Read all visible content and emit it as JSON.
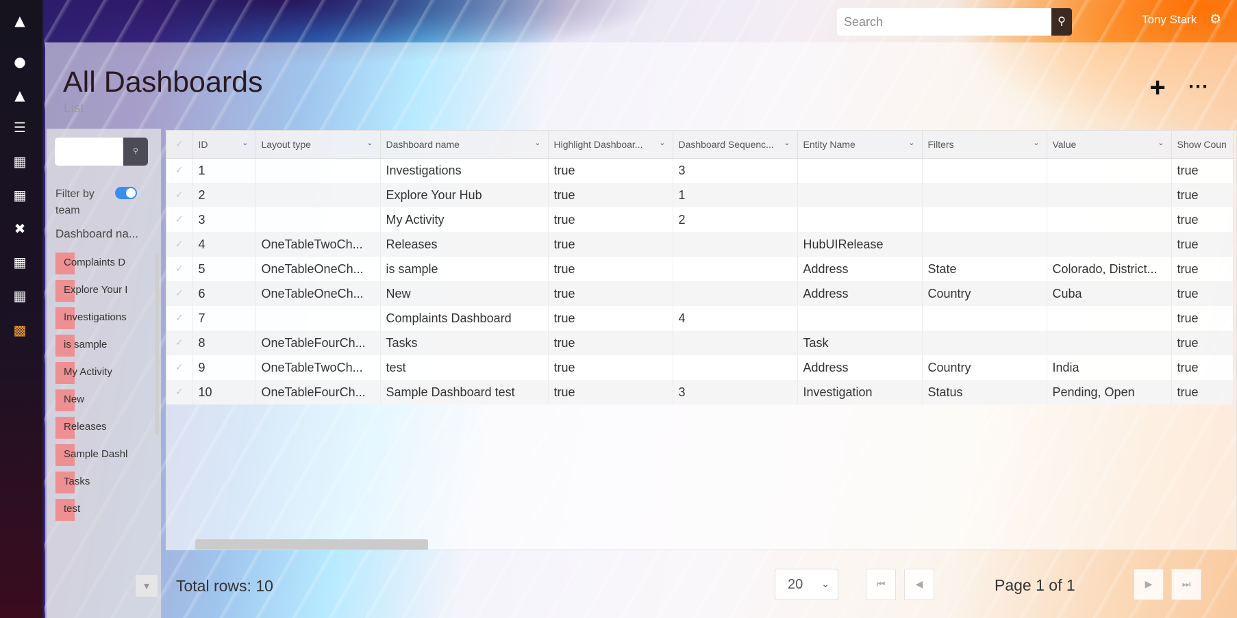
{
  "topbar": {
    "search_placeholder": "Search",
    "user_name": "Tony Stark"
  },
  "page": {
    "title": "All Dashboards",
    "subtitle": "List"
  },
  "filter_panel": {
    "filter_by_team_label": "Filter by team",
    "filter_by_team_enabled": true,
    "column_header": "Dashboard na...",
    "items": [
      "Complaints D",
      "Explore Your I",
      "Investigations",
      "is sample",
      "My Activity",
      "New",
      "Releases",
      "Sample Dashl",
      "Tasks",
      "test"
    ]
  },
  "grid": {
    "columns": [
      "ID",
      "Layout type",
      "Dashboard name",
      "Highlight Dashboar...",
      "Dashboard Sequenc...",
      "Entity Name",
      "Filters",
      "Value",
      "Show Coun"
    ],
    "rows": [
      [
        "1",
        "",
        "Investigations",
        "true",
        "3",
        "",
        "",
        "",
        "true"
      ],
      [
        "2",
        "",
        "Explore Your Hub",
        "true",
        "1",
        "",
        "",
        "",
        "true"
      ],
      [
        "3",
        "",
        "My Activity",
        "true",
        "2",
        "",
        "",
        "",
        "true"
      ],
      [
        "4",
        "OneTableTwoCh...",
        "Releases",
        "true",
        "",
        "HubUIRelease",
        "",
        "",
        "true"
      ],
      [
        "5",
        "OneTableOneCh...",
        "is sample",
        "true",
        "",
        "Address",
        "State",
        "Colorado, District...",
        "true"
      ],
      [
        "6",
        "OneTableOneCh...",
        "New",
        "true",
        "",
        "Address",
        "Country",
        "Cuba",
        "true"
      ],
      [
        "7",
        "",
        "Complaints Dashboard",
        "true",
        "4",
        "",
        "",
        "",
        "true"
      ],
      [
        "8",
        "OneTableFourCh...",
        "Tasks",
        "true",
        "",
        "Task",
        "",
        "",
        "true"
      ],
      [
        "9",
        "OneTableTwoCh...",
        "test",
        "true",
        "",
        "Address",
        "Country",
        "India",
        "true"
      ],
      [
        "10",
        "OneTableFourCh...",
        "Sample Dashboard test",
        "true",
        "3",
        "Investigation",
        "Status",
        "Pending, Open",
        "true"
      ]
    ]
  },
  "footer": {
    "total_rows": "Total rows: 10",
    "page_size": "20",
    "page_label": "Page 1 of 1"
  },
  "icons": {
    "accent": "#f0a030",
    "rail": [
      "home-icon",
      "user-icon",
      "hierarchy-icon",
      "list-icon",
      "table-icon",
      "grid-icon",
      "close-icon",
      "table-icon",
      "table-icon",
      "dashboard-icon"
    ]
  }
}
